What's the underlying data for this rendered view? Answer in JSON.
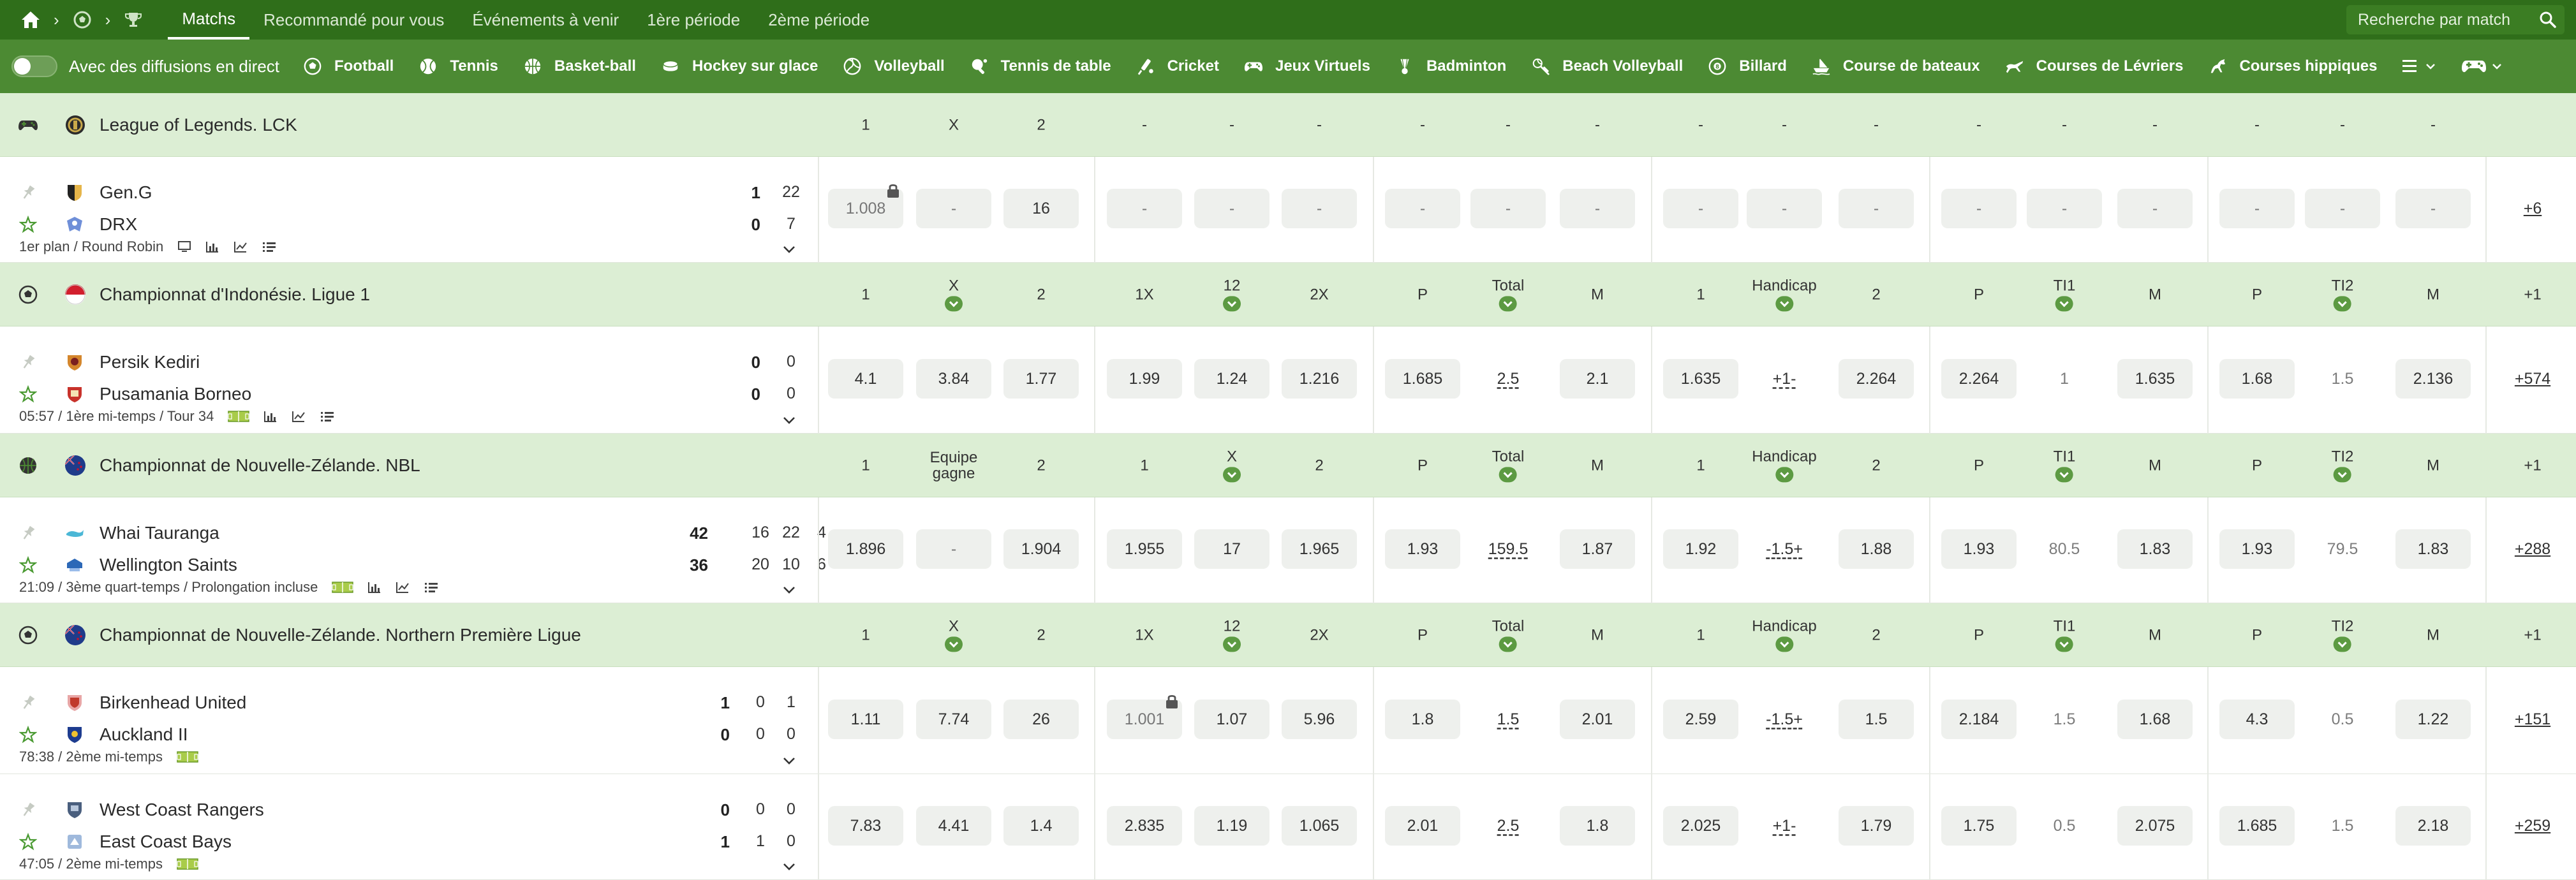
{
  "nav": {
    "tabs": [
      "Matchs",
      "Recommandé pour vous",
      "Événements à venir",
      "1ère période",
      "2ème période"
    ],
    "search_placeholder": "Recherche par match"
  },
  "sports_bar": {
    "live_label": "Avec des diffusions en direct",
    "sports": [
      {
        "label": "Football",
        "icon": "football-icon"
      },
      {
        "label": "Tennis",
        "icon": "tennis-icon"
      },
      {
        "label": "Basket-ball",
        "icon": "basketball-icon"
      },
      {
        "label": "Hockey sur glace",
        "icon": "hockey-icon"
      },
      {
        "label": "Volleyball",
        "icon": "volleyball-icon"
      },
      {
        "label": "Tennis de table",
        "icon": "table-tennis-icon"
      },
      {
        "label": "Cricket",
        "icon": "cricket-icon"
      },
      {
        "label": "Jeux Virtuels",
        "icon": "gamepad-icon"
      },
      {
        "label": "Badminton",
        "icon": "badminton-icon"
      },
      {
        "label": "Beach Volleyball",
        "icon": "beach-volleyball-icon"
      },
      {
        "label": "Billard",
        "icon": "billiards-icon"
      },
      {
        "label": "Course de bateaux",
        "icon": "boat-icon"
      },
      {
        "label": "Courses de Lévriers",
        "icon": "greyhound-icon"
      },
      {
        "label": "Courses hippiques",
        "icon": "horse-icon"
      }
    ]
  },
  "leagues": [
    {
      "name": "League of Legends. LCK",
      "sport_icon": "gamepad-icon",
      "headers": [
        "1",
        "X",
        "2",
        "-",
        "-",
        "-",
        "-",
        "-",
        "-",
        "-",
        "-",
        "-",
        "-",
        "-",
        "-",
        "-",
        "-",
        "-",
        ""
      ],
      "chevrons": [],
      "matches": [
        {
          "team1": "Gen.G",
          "team2": "DRX",
          "score1": "1",
          "score2": "0",
          "sub1": [
            "22"
          ],
          "sub2": [
            "7"
          ],
          "info": "1er plan / Round Robin",
          "cells": [
            {
              "t": "odd",
              "v": "1.008",
              "muted": true,
              "lock": true
            },
            {
              "t": "odd",
              "v": "-",
              "muted": true
            },
            {
              "t": "odd",
              "v": "16"
            },
            {
              "t": "odd",
              "v": "-",
              "muted": true
            },
            {
              "t": "odd",
              "v": "-",
              "muted": true
            },
            {
              "t": "odd",
              "v": "-",
              "muted": true
            },
            {
              "t": "odd",
              "v": "-",
              "muted": true
            },
            {
              "t": "odd",
              "v": "-",
              "muted": true
            },
            {
              "t": "odd",
              "v": "-",
              "muted": true
            },
            {
              "t": "odd",
              "v": "-",
              "muted": true
            },
            {
              "t": "odd",
              "v": "-",
              "muted": true
            },
            {
              "t": "odd",
              "v": "-",
              "muted": true
            },
            {
              "t": "odd",
              "v": "-",
              "muted": true
            },
            {
              "t": "odd",
              "v": "-",
              "muted": true
            },
            {
              "t": "odd",
              "v": "-",
              "muted": true
            },
            {
              "t": "odd",
              "v": "-",
              "muted": true
            },
            {
              "t": "odd",
              "v": "-",
              "muted": true
            },
            {
              "t": "odd",
              "v": "-",
              "muted": true
            },
            {
              "t": "more",
              "v": "+6"
            }
          ]
        }
      ]
    },
    {
      "name": "Championnat d'Indonésie. Ligue 1",
      "sport_icon": "football-icon",
      "headers": [
        "1",
        "X",
        "2",
        "1X",
        "12",
        "2X",
        "P",
        "Total",
        "M",
        "1",
        "Handicap",
        "2",
        "P",
        "TI1",
        "M",
        "P",
        "TI2",
        "M",
        "+1"
      ],
      "chevrons": [
        1,
        4,
        7,
        10,
        13,
        16
      ],
      "matches": [
        {
          "team1": "Persik Kediri",
          "team2": "Pusamania Borneo",
          "score1": "0",
          "score2": "0",
          "sub1": [
            "0"
          ],
          "sub2": [
            "0"
          ],
          "info": "05:57 / 1ère mi-temps / Tour 34",
          "cells": [
            {
              "t": "odd",
              "v": "4.1"
            },
            {
              "t": "odd",
              "v": "3.84"
            },
            {
              "t": "odd",
              "v": "1.77"
            },
            {
              "t": "odd",
              "v": "1.99"
            },
            {
              "t": "odd",
              "v": "1.24"
            },
            {
              "t": "odd",
              "v": "1.216"
            },
            {
              "t": "odd",
              "v": "1.685"
            },
            {
              "t": "param",
              "v": "2.5"
            },
            {
              "t": "odd",
              "v": "2.1"
            },
            {
              "t": "odd",
              "v": "1.635"
            },
            {
              "t": "param",
              "v": "+1-"
            },
            {
              "t": "odd",
              "v": "2.264"
            },
            {
              "t": "odd",
              "v": "2.264"
            },
            {
              "t": "plain",
              "v": "1"
            },
            {
              "t": "odd",
              "v": "1.635"
            },
            {
              "t": "odd",
              "v": "1.68"
            },
            {
              "t": "plain",
              "v": "1.5"
            },
            {
              "t": "odd",
              "v": "2.136"
            },
            {
              "t": "more",
              "v": "+574"
            }
          ]
        }
      ]
    },
    {
      "name": "Championnat de Nouvelle-Zélande. NBL",
      "sport_icon": "basketball-icon",
      "headers": [
        "1",
        "Equipe gagne",
        "2",
        "1",
        "X",
        "2",
        "P",
        "Total",
        "M",
        "1",
        "Handicap",
        "2",
        "P",
        "TI1",
        "M",
        "P",
        "TI2",
        "M",
        "+1"
      ],
      "chevrons": [
        4,
        7,
        10,
        13,
        16
      ],
      "matches": [
        {
          "team1": "Whai Tauranga",
          "team2": "Wellington Saints",
          "score1": "42",
          "score2": "36",
          "sub1": [
            "16",
            "22",
            "4"
          ],
          "sub2": [
            "20",
            "10",
            "6"
          ],
          "info": "21:09 / 3ème quart-temps / Prolongation incluse",
          "cells": [
            {
              "t": "odd",
              "v": "1.896"
            },
            {
              "t": "odd",
              "v": "-",
              "muted": true
            },
            {
              "t": "odd",
              "v": "1.904"
            },
            {
              "t": "odd",
              "v": "1.955"
            },
            {
              "t": "odd",
              "v": "17"
            },
            {
              "t": "odd",
              "v": "1.965"
            },
            {
              "t": "odd",
              "v": "1.93"
            },
            {
              "t": "param",
              "v": "159.5"
            },
            {
              "t": "odd",
              "v": "1.87"
            },
            {
              "t": "odd",
              "v": "1.92"
            },
            {
              "t": "param",
              "v": "-1.5+"
            },
            {
              "t": "odd",
              "v": "1.88"
            },
            {
              "t": "odd",
              "v": "1.93"
            },
            {
              "t": "plain",
              "v": "80.5"
            },
            {
              "t": "odd",
              "v": "1.83"
            },
            {
              "t": "odd",
              "v": "1.93"
            },
            {
              "t": "plain",
              "v": "79.5"
            },
            {
              "t": "odd",
              "v": "1.83"
            },
            {
              "t": "more",
              "v": "+288"
            }
          ]
        }
      ]
    },
    {
      "name": "Championnat de Nouvelle-Zélande. Northern Première Ligue",
      "sport_icon": "football-icon",
      "headers": [
        "1",
        "X",
        "2",
        "1X",
        "12",
        "2X",
        "P",
        "Total",
        "M",
        "1",
        "Handicap",
        "2",
        "P",
        "TI1",
        "M",
        "P",
        "TI2",
        "M",
        "+1"
      ],
      "chevrons": [
        1,
        4,
        7,
        10,
        13,
        16
      ],
      "matches": [
        {
          "team1": "Birkenhead United",
          "team2": "Auckland II",
          "score1": "1",
          "score2": "0",
          "sub1": [
            "0",
            "1"
          ],
          "sub2": [
            "0",
            "0"
          ],
          "info": "78:38 / 2ème mi-temps",
          "cells": [
            {
              "t": "odd",
              "v": "1.11"
            },
            {
              "t": "odd",
              "v": "7.74"
            },
            {
              "t": "odd",
              "v": "26"
            },
            {
              "t": "odd",
              "v": "1.001",
              "muted": true,
              "lock": true
            },
            {
              "t": "odd",
              "v": "1.07"
            },
            {
              "t": "odd",
              "v": "5.96"
            },
            {
              "t": "odd",
              "v": "1.8"
            },
            {
              "t": "param",
              "v": "1.5"
            },
            {
              "t": "odd",
              "v": "2.01"
            },
            {
              "t": "odd",
              "v": "2.59"
            },
            {
              "t": "param",
              "v": "-1.5+"
            },
            {
              "t": "odd",
              "v": "1.5"
            },
            {
              "t": "odd",
              "v": "2.184"
            },
            {
              "t": "plain",
              "v": "1.5"
            },
            {
              "t": "odd",
              "v": "1.68"
            },
            {
              "t": "odd",
              "v": "4.3"
            },
            {
              "t": "plain",
              "v": "0.5"
            },
            {
              "t": "odd",
              "v": "1.22"
            },
            {
              "t": "more",
              "v": "+151"
            }
          ]
        },
        {
          "team1": "West Coast Rangers",
          "team2": "East Coast Bays",
          "score1": "0",
          "score2": "1",
          "sub1": [
            "0",
            "0"
          ],
          "sub2": [
            "1",
            "0"
          ],
          "info": "47:05 / 2ème mi-temps",
          "cells": [
            {
              "t": "odd",
              "v": "7.83"
            },
            {
              "t": "odd",
              "v": "4.41"
            },
            {
              "t": "odd",
              "v": "1.4"
            },
            {
              "t": "odd",
              "v": "2.835"
            },
            {
              "t": "odd",
              "v": "1.19"
            },
            {
              "t": "odd",
              "v": "1.065"
            },
            {
              "t": "odd",
              "v": "2.01"
            },
            {
              "t": "param",
              "v": "2.5"
            },
            {
              "t": "odd",
              "v": "1.8"
            },
            {
              "t": "odd",
              "v": "2.025"
            },
            {
              "t": "param",
              "v": "+1-"
            },
            {
              "t": "odd",
              "v": "1.79"
            },
            {
              "t": "odd",
              "v": "1.75"
            },
            {
              "t": "plain",
              "v": "0.5"
            },
            {
              "t": "odd",
              "v": "2.075"
            },
            {
              "t": "odd",
              "v": "1.685"
            },
            {
              "t": "plain",
              "v": "1.5"
            },
            {
              "t": "odd",
              "v": "2.18"
            },
            {
              "t": "more",
              "v": "+259"
            }
          ]
        }
      ]
    }
  ],
  "colors": {
    "nav": "#2f6e1a",
    "sports_bar": "#4c8a33",
    "league_row": "#dceed4",
    "odd_bg": "#eef0ed"
  }
}
